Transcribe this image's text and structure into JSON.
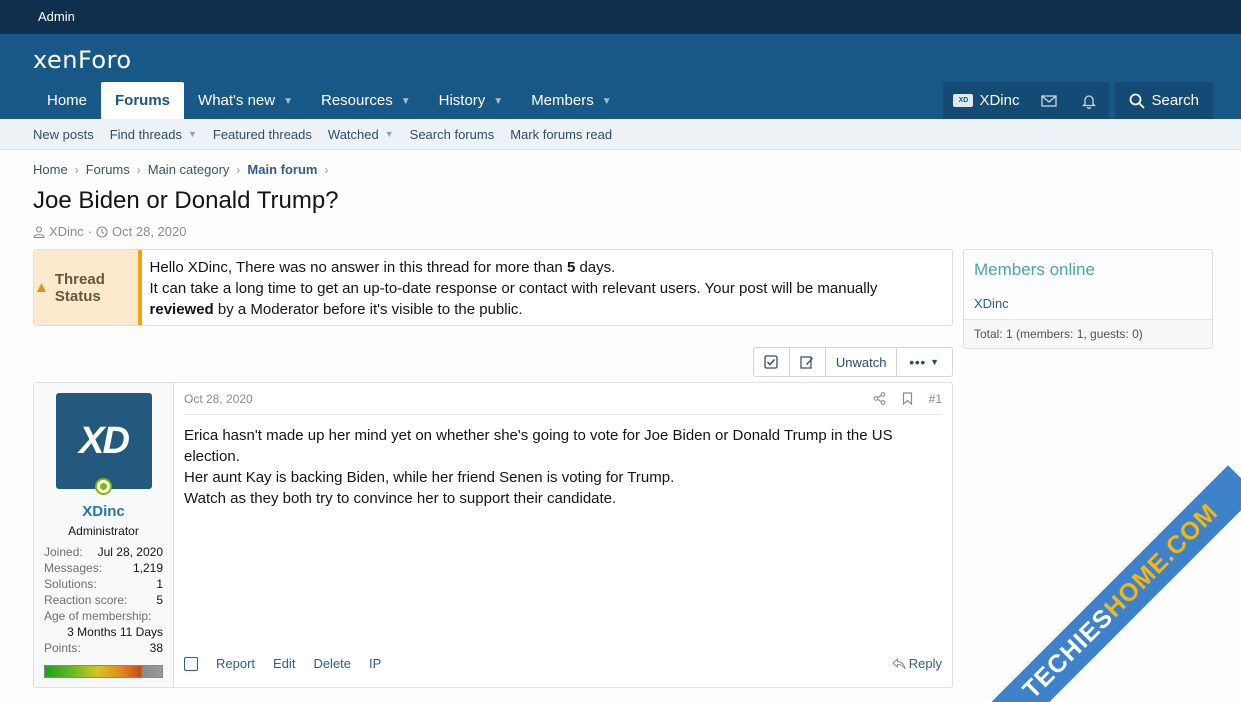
{
  "admin_bar": {
    "label": "Admin"
  },
  "header": {
    "logo": "xenForo",
    "nav": [
      {
        "label": "Home"
      },
      {
        "label": "Forums"
      },
      {
        "label": "What's new"
      },
      {
        "label": "Resources"
      },
      {
        "label": "History"
      },
      {
        "label": "Members"
      }
    ],
    "user": {
      "name": "XDinc",
      "avatar_text": "XD"
    },
    "search_label": "Search"
  },
  "sub_nav": [
    {
      "label": "New posts"
    },
    {
      "label": "Find threads"
    },
    {
      "label": "Featured threads"
    },
    {
      "label": "Watched"
    },
    {
      "label": "Search forums"
    },
    {
      "label": "Mark forums read"
    }
  ],
  "breadcrumb": [
    "Home",
    "Forums",
    "Main category",
    "Main forum"
  ],
  "thread": {
    "title": "Joe Biden or Donald Trump?",
    "author": "XDinc",
    "date": "Oct 28, 2020"
  },
  "notice": {
    "label": "Thread Status",
    "line1_pre": "Hello XDinc, There was no answer in this thread for more than ",
    "line1_days": "5",
    "line1_post": " days.",
    "line2_pre": "It can take a long time to get an up-to-date response or contact with relevant users. Your post will be manually ",
    "line2_bold": "reviewed",
    "line2_post": " by a Moderator before it's visible to the public."
  },
  "thread_actions": {
    "unwatch": "Unwatch",
    "more": "•••"
  },
  "post": {
    "user": {
      "avatar_text": "XD",
      "name": "XDinc",
      "title": "Administrator",
      "joined_label": "Joined:",
      "joined": "Jul 28, 2020",
      "messages_label": "Messages:",
      "messages": "1,219",
      "solutions_label": "Solutions:",
      "solutions": "1",
      "reaction_label": "Reaction score:",
      "reaction": "5",
      "age_label": "Age of membership:",
      "age": "3 Months 11 Days",
      "points_label": "Points:",
      "points": "38"
    },
    "date": "Oct 28, 2020",
    "number": "#1",
    "body": [
      "Erica hasn't made up her mind yet on whether she's going to vote for Joe Biden or Donald Trump in the US election.",
      "Her aunt Kay is backing Biden, while her friend Senen is voting for Trump.",
      "Watch as they both try to convince her to support their candidate."
    ],
    "footer": {
      "report": "Report",
      "edit": "Edit",
      "delete": "Delete",
      "ip": "IP",
      "reply": "Reply"
    }
  },
  "sidebar": {
    "members_title": "Members online",
    "members": [
      "XDinc"
    ],
    "total": "Total: 1 (members: 1, guests: 0)"
  },
  "watermark": {
    "part1": "TECHIES",
    "part2": "HOME.COM"
  },
  "colors": {
    "header": "#185886",
    "admin_bar": "#0f2f4f",
    "notice_accent": "#f0a519",
    "link": "#2c5f8f"
  }
}
